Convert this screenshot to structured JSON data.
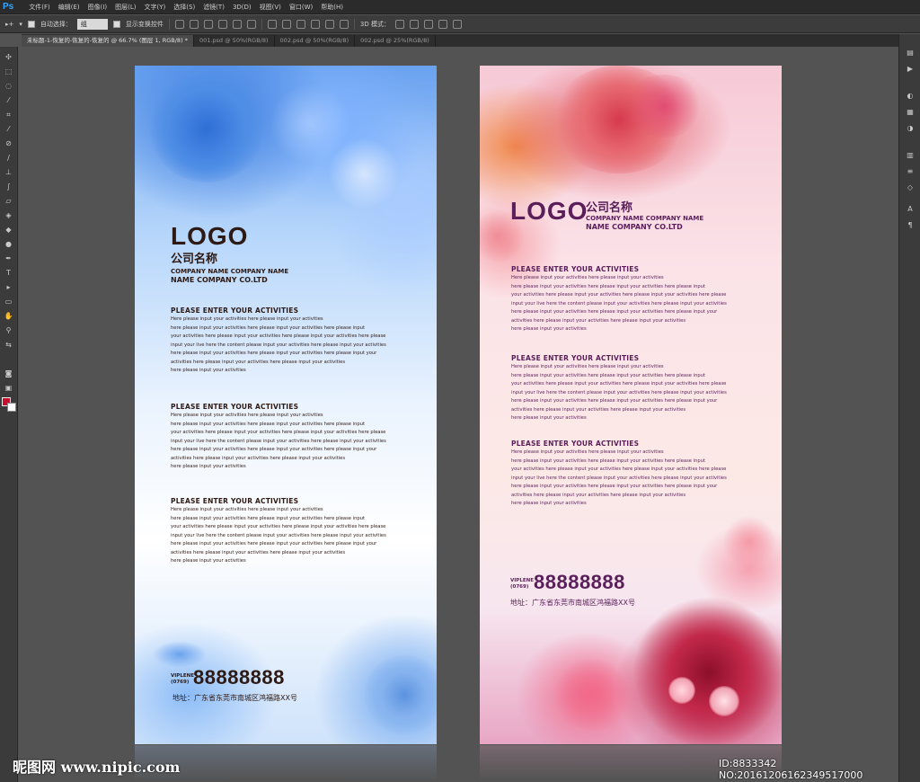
{
  "app": {
    "logo": "Ps"
  },
  "menu": [
    "文件(F)",
    "编辑(E)",
    "图像(I)",
    "图层(L)",
    "文字(Y)",
    "选择(S)",
    "滤镜(T)",
    "3D(D)",
    "视图(V)",
    "窗口(W)",
    "帮助(H)"
  ],
  "options": {
    "auto_select_label": "自动选择：",
    "auto_select_value": "组",
    "show_transform_label": "显示变换控件",
    "mode_3d_label": "3D 模式："
  },
  "tabs": [
    {
      "label": "未标题-1-恢复的-恢复的-恢复的 @ 66.7% (图层 1, RGB/8) *",
      "active": true
    },
    {
      "label": "001.psd @ 50%(RGB/8)",
      "active": false
    },
    {
      "label": "002.psd @ 50%(RGB/8)",
      "active": false
    },
    {
      "label": "002.psd @ 25%(RGB/8)",
      "active": false
    }
  ],
  "poster_blue": {
    "logo": "LOGO",
    "company_cn": "公司名称",
    "company_en_line1": "COMPANY NAME COMPANY NAME",
    "company_en_line2": "NAME COMPANY CO.LTD",
    "sections": [
      {
        "title": "PLEASE ENTER YOUR ACTIVITIES",
        "body": "Here please input your activities here please input your activities\nhere please input your activities here please input your activities here please input\nyour activities here please input your activities here please input your activities here please\ninput your live here the content please input your activities here please input your activities\nhere please input your activities here please input your activities here please input your\nactivities here please input your activities here please input your activities\nhere please input your activities"
      },
      {
        "title": "PLEASE ENTER YOUR ACTIVITIES",
        "body": "Here please input your activities here please input your activities\nhere please input your activities here please input your activities here please input\nyour activities here please input your activities here please input your activities here please\ninput your live here the content please input your activities here please input your activities\nhere please input your activities here please input your activities here please input your\nactivities here please input your activities here please input your activities\nhere please input your activities"
      },
      {
        "title": "PLEASE ENTER YOUR ACTIVITIES",
        "body": "Here please input your activities here please input your activities\nhere please input your activities here please input your activities here please input\nyour activities here please input your activities here please input your activities here please\ninput your live here the content please input your activities here please input your activities\nhere please input your activities here please input your activities here please input your\nactivities here please input your activities here please input your activities\nhere please input your activities"
      }
    ],
    "phone_label_1": "VIPLENE",
    "phone_label_2": "(0769)",
    "phone": "88888888",
    "address": "地址：广东省东莞市南城区鸿福路XX号"
  },
  "poster_pink": {
    "logo": "LOGO",
    "company_cn": "公司名称",
    "company_en_line1": "COMPANY NAME COMPANY NAME",
    "company_en_line2": "NAME COMPANY CO.LTD",
    "sections": [
      {
        "title": "PLEASE ENTER YOUR ACTIVITIES",
        "body": "Here please input your activities here please input your activities\nhere please input your activities here please input your activities here please input\nyour activities here please input your activities here please input your activities here please\ninput your live here the content please input your activities here please input your activities\nhere please input your activities here please input your activities here please input your\nactivities here please input your activities here please input your activities\nhere please input your activities"
      },
      {
        "title": "PLEASE ENTER YOUR ACTIVITIES",
        "body": "Here please input your activities here please input your activities\nhere please input your activities here please input your activities here please input\nyour activities here please input your activities here please input your activities here please\ninput your live here the content please input your activities here please input your activities\nhere please input your activities here please input your activities here please input your\nactivities here please input your activities here please input your activities\nhere please input your activities"
      },
      {
        "title": "PLEASE ENTER YOUR ACTIVITIES",
        "body": "Here please input your activities here please input your activities\nhere please input your activities here please input your activities here please input\nyour activities here please input your activities here please input your activities here please\ninput your live here the content please input your activities here please input your activities\nhere please input your activities here please input your activities here please input your\nactivities here please input your activities here please input your activities\nhere please input your activities"
      }
    ],
    "phone_label_1": "VIPLENE",
    "phone_label_2": "(0769)",
    "phone": "88888888",
    "address": "地址：广东省东莞市南城区鸿福路XX号"
  },
  "watermark": {
    "left": "昵图网 www.nipic.com",
    "right": "ID:8833342 NO:20161206162349517000"
  },
  "colors": {
    "fg_swatch": "#c8102e",
    "bg_swatch": "#ffffff",
    "blue_text": "#2e1a14",
    "pink_text": "#5a1f5a"
  }
}
